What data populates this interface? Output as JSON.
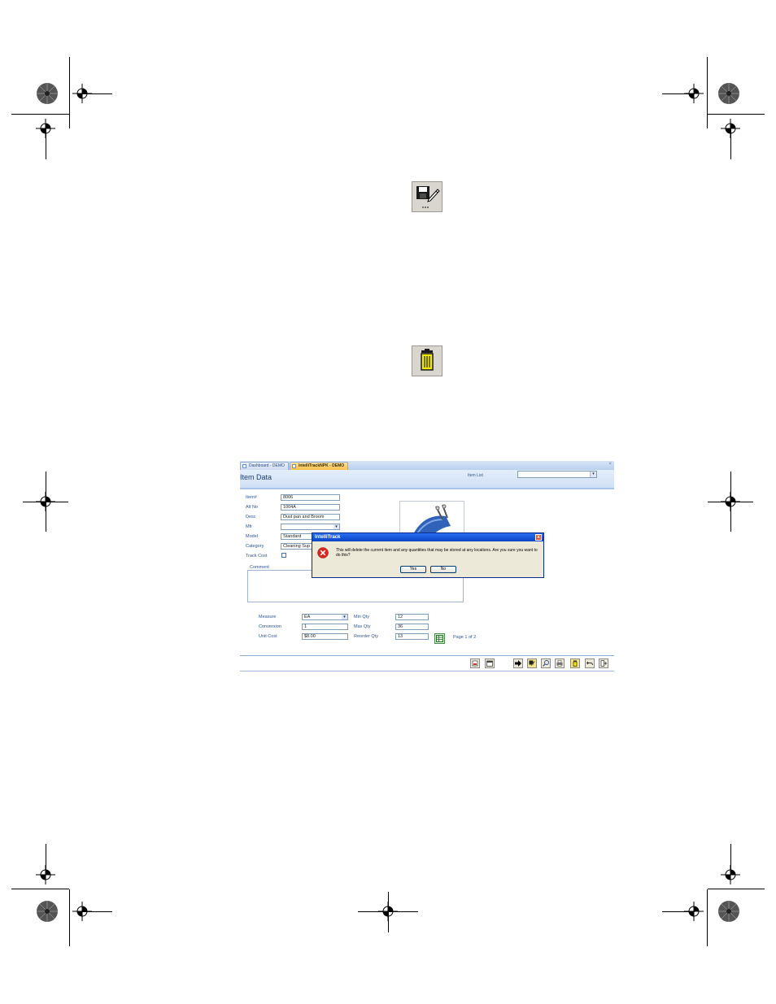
{
  "app": {
    "tabs": [
      {
        "label": "Dashboard - DEMO"
      },
      {
        "label": "IntelliTrackNPK - DEMO"
      }
    ],
    "close_glyph": "×",
    "title": "Item Data",
    "item_list_label": "Item List",
    "item_list_value": ""
  },
  "form": {
    "fields": [
      {
        "label": "Item#",
        "value": "8006"
      },
      {
        "label": "Alt No",
        "value": "1004A"
      },
      {
        "label": "Desc",
        "value": "Dust pan and Broom"
      },
      {
        "label": "Mfr",
        "value": ""
      },
      {
        "label": "Model",
        "value": "Standard"
      },
      {
        "label": "Category",
        "value": "Cleaning Sup"
      }
    ],
    "track_cost_label": "Track Cost",
    "comment_label": "Comment",
    "measure_label": "Measure",
    "measure_value": "EA",
    "conversion_label": "Conversion",
    "conversion_value": "1",
    "unit_cost_label": "Unit Cost",
    "unit_cost_value": "$8.00",
    "min_qty_label": "Min Qty",
    "min_qty_value": "12",
    "max_qty_label": "Max Qty",
    "max_qty_value": "36",
    "reorder_qty_label": "Reorder Qty",
    "reorder_qty_value": "13",
    "page_label": "Page 1 of 2"
  },
  "dialog": {
    "title": "IntelliTrack",
    "message": "This will delete the current item and any quantities that may be stored at any locations. Are you sure you want to do this?",
    "yes_label": "Yes",
    "no_label": "No",
    "close_glyph": "x"
  },
  "icons": {
    "save_edit": "save-edit-icon",
    "delete": "trash-icon",
    "error": "error-icon",
    "product_photo": "dustpan-broom-icon"
  },
  "colors": {
    "tab_active": "#f8bf4a",
    "header_bg": "#cfdff4",
    "dialog_title": "#0845c4",
    "error_red": "#d9261c"
  }
}
